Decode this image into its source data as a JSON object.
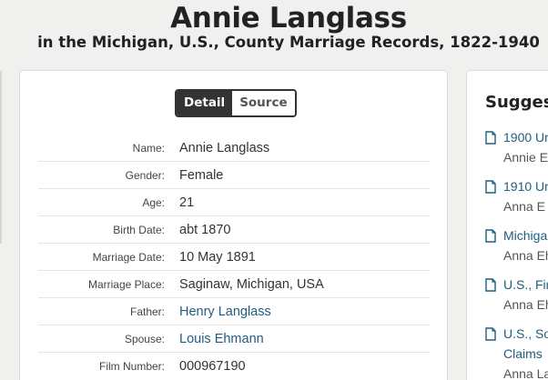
{
  "header": {
    "title": "Annie Langlass",
    "subtitle": "in the Michigan, U.S., County Marriage Records, 1822-1940"
  },
  "toggle": {
    "detail_label": "Detail",
    "source_label": "Source",
    "active": "Detail"
  },
  "record": {
    "rows": [
      {
        "label": "Name:",
        "value": "Annie Langlass",
        "link": false
      },
      {
        "label": "Gender:",
        "value": "Female",
        "link": false
      },
      {
        "label": "Age:",
        "value": "21",
        "link": false
      },
      {
        "label": "Birth Date:",
        "value": "abt 1870",
        "link": false
      },
      {
        "label": "Marriage Date:",
        "value": "10 May 1891",
        "link": false
      },
      {
        "label": "Marriage Place:",
        "value": "Saginaw, Michigan, USA",
        "link": false
      },
      {
        "label": "Father:",
        "value": "Henry Langlass",
        "link": true
      },
      {
        "label": "Spouse:",
        "value": "Louis Ehmann",
        "link": true
      },
      {
        "label": "Film Number:",
        "value": "000967190",
        "link": false
      }
    ]
  },
  "suggested": {
    "title": "Suggest",
    "items": [
      {
        "link": "1900 Ur",
        "sub": "Annie E"
      },
      {
        "link": "1910 Ur",
        "sub": "Anna E"
      },
      {
        "link": "Michiga",
        "sub": "Anna Eh"
      },
      {
        "link": "U.S., Fir",
        "sub": "Anna Eh"
      },
      {
        "link": "U.S., So",
        "link2": "Claims",
        "sub": "Anna La"
      }
    ]
  },
  "colors": {
    "link": "#1f5d80",
    "toggle_active_bg": "#333333",
    "page_bg": "#f0f0ef"
  },
  "icons": {
    "suggestion": "document-icon"
  }
}
